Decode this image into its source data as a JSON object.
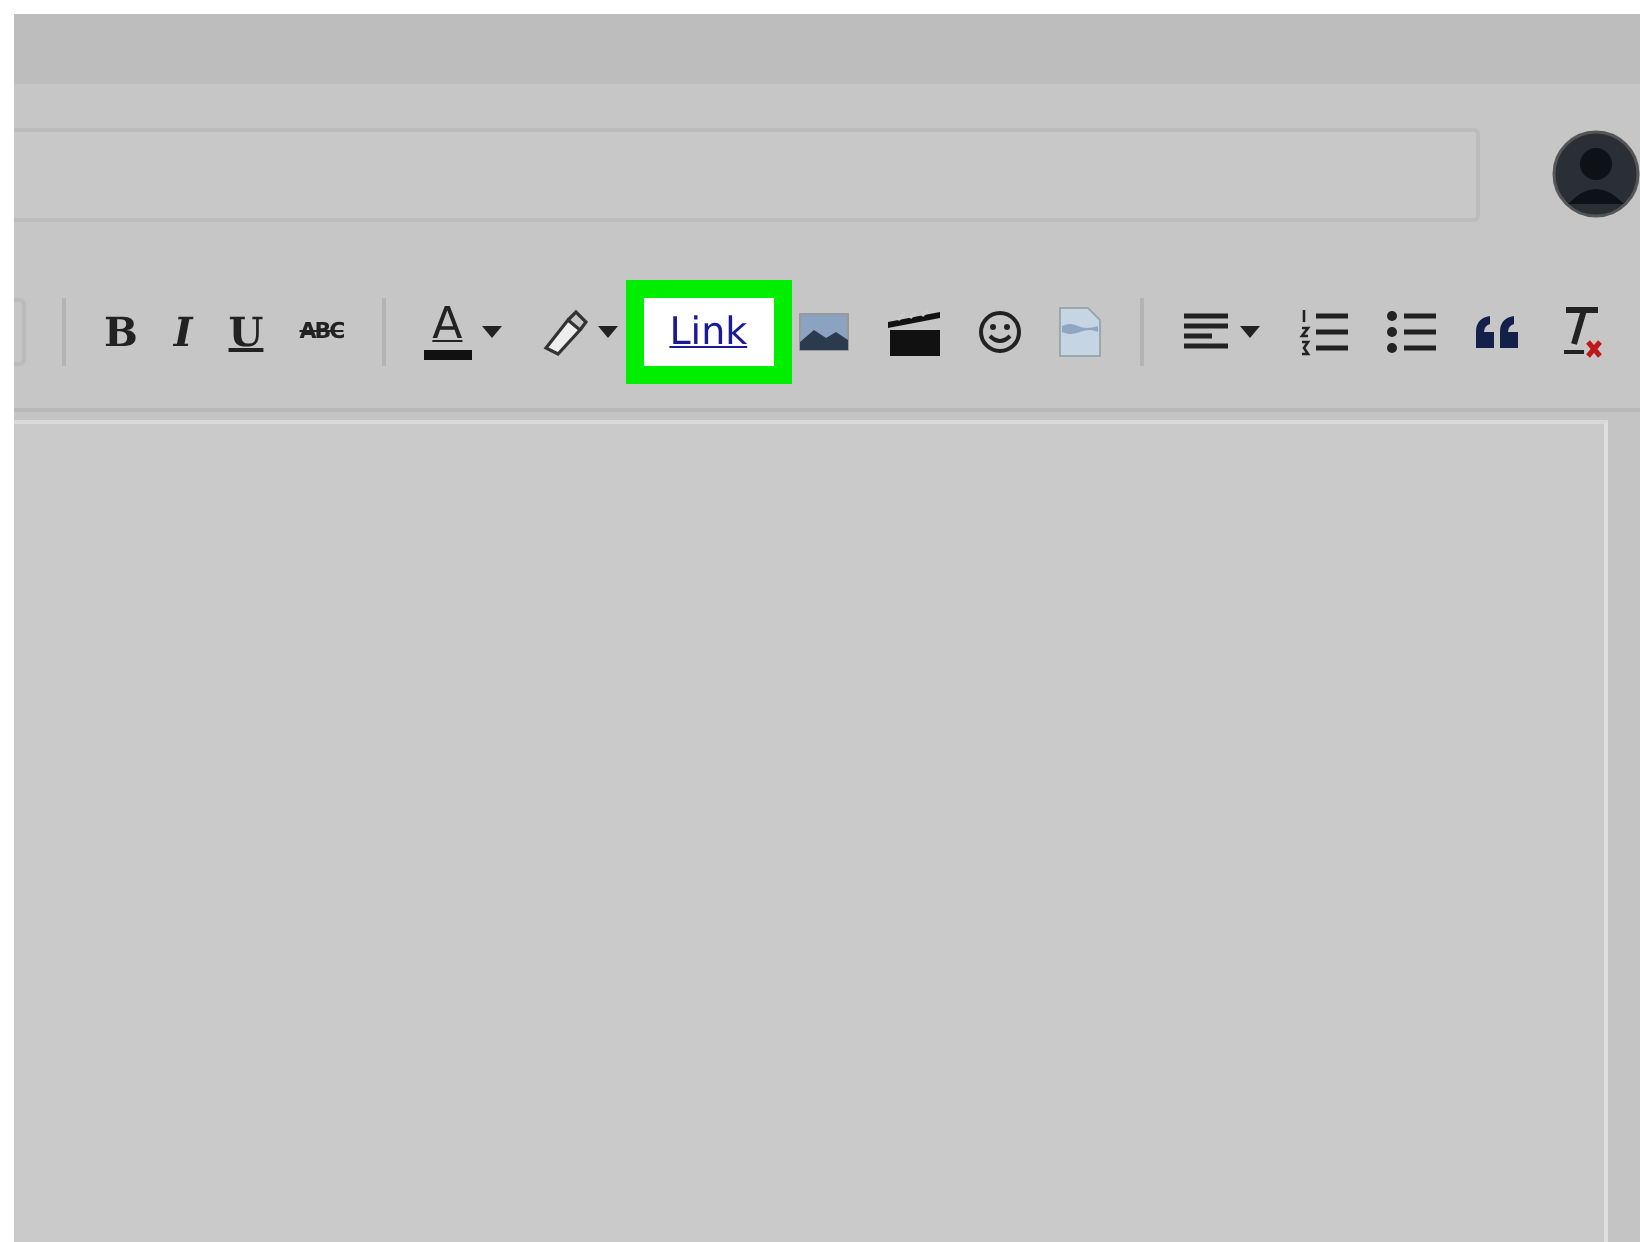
{
  "toolbar": {
    "groups": [
      [
        {
          "kind": "bold",
          "label": "B"
        },
        {
          "kind": "italic",
          "label": "I"
        },
        {
          "kind": "underline",
          "label": "U"
        },
        {
          "kind": "strike",
          "label": "ABC"
        }
      ],
      [
        {
          "kind": "color-menu",
          "label": "A"
        },
        {
          "kind": "highlight-menu"
        },
        {
          "kind": "link",
          "label": "Link",
          "highlighted": true
        },
        {
          "kind": "image"
        },
        {
          "kind": "video"
        },
        {
          "kind": "emoji"
        },
        {
          "kind": "picture-file"
        }
      ],
      [
        {
          "kind": "align-menu"
        },
        {
          "kind": "numbered-list"
        },
        {
          "kind": "bullet-list"
        },
        {
          "kind": "quote"
        },
        {
          "kind": "clear-format"
        }
      ]
    ]
  }
}
